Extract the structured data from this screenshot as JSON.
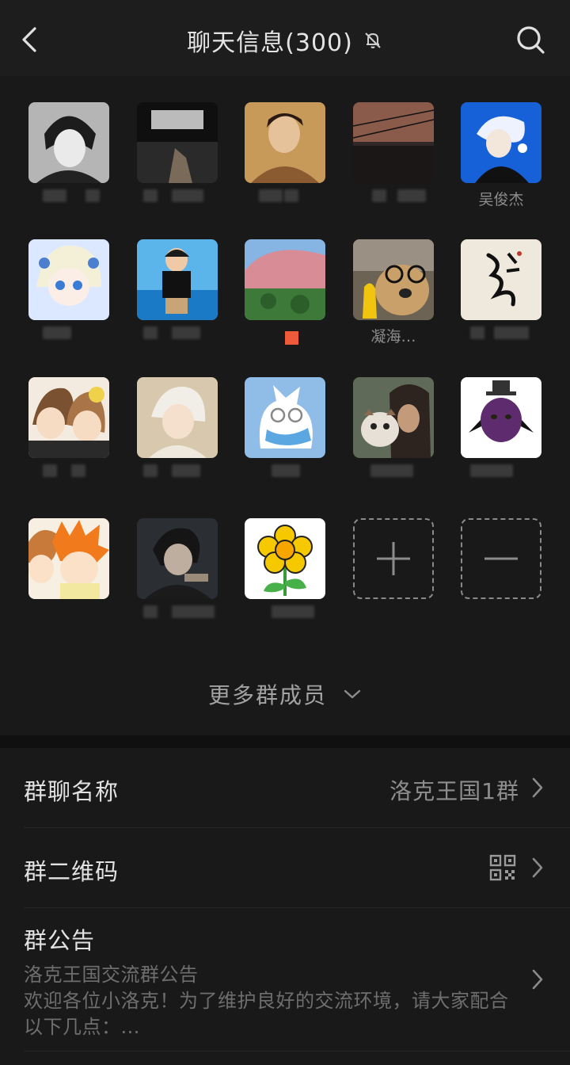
{
  "header": {
    "title": "聊天信息(300)",
    "back_icon": "chevron-left-icon",
    "mute_icon": "bell-off-icon",
    "search_icon": "search-icon"
  },
  "members": {
    "rows": [
      [
        {
          "name": ""
        },
        {
          "name": ""
        },
        {
          "name": ""
        },
        {
          "name": ""
        },
        {
          "name": "吴俊杰"
        }
      ],
      [
        {
          "name": ""
        },
        {
          "name": ""
        },
        {
          "name": ""
        },
        {
          "name": "凝海…"
        },
        {
          "name": ""
        }
      ],
      [
        {
          "name": ""
        },
        {
          "name": ""
        },
        {
          "name": ""
        },
        {
          "name": ""
        },
        {
          "name": ""
        }
      ],
      [
        {
          "name": ""
        },
        {
          "name": ""
        },
        {
          "name": ""
        }
      ]
    ],
    "add_icon": "plus-icon",
    "remove_icon": "minus-icon",
    "more_label": "更多群成员"
  },
  "settings": {
    "group_name_label": "群聊名称",
    "group_name_value": "洛克王国1群",
    "qr_label": "群二维码",
    "qr_icon": "qr-code-icon",
    "notice_label": "群公告",
    "notice_title": "洛克王国交流群公告",
    "notice_body": "欢迎各位小洛克！为了维护良好的交流环境，请大家配合以下几点：..."
  }
}
